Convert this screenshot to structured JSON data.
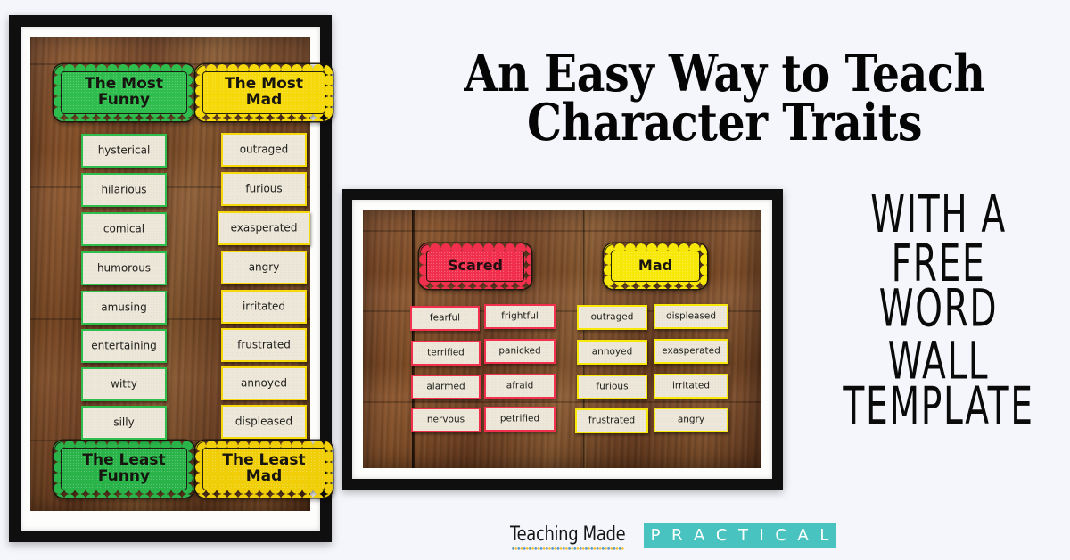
{
  "page": {
    "background_color": "#f5f6fc",
    "title_line1": "An Easy Way to Teach",
    "title_line2": "Character Traits",
    "subtext_lines": [
      "With a",
      "Free",
      "Word Wall",
      "Template"
    ]
  },
  "logo": {
    "brand_script": "Teaching Made",
    "brand_block": "P R A C T I C A L",
    "block_bg_color": "#49c3c0",
    "dot_colors": [
      "#e8443c",
      "#f0c030",
      "#4aa3d8",
      "#5cb85c",
      "#f0883c"
    ]
  },
  "photo_left": {
    "frame_color": "#100f0f",
    "mat_color": "#fdfdfb",
    "columns": [
      {
        "name": "funny",
        "accent_color": "#2fbd4e",
        "top_label": "The Most\nFunny",
        "top_label_line1": "The Most",
        "top_label_line2": "Funny",
        "bottom_label_line1": "The Least",
        "bottom_label_line2": "Funny",
        "words": [
          "hysterical",
          "hilarious",
          "comical",
          "humorous",
          "amusing",
          "entertaining",
          "witty",
          "silly"
        ]
      },
      {
        "name": "mad",
        "accent_color": "#f5d90a",
        "top_label_line1": "The Most",
        "top_label_line2": "Mad",
        "bottom_label_line1": "The Least",
        "bottom_label_line2": "Mad",
        "words": [
          "outraged",
          "furious",
          "exasperated",
          "angry",
          "irritated",
          "frustrated",
          "annoyed",
          "displeased"
        ]
      }
    ]
  },
  "photo_right": {
    "frame_color": "#100f0f",
    "mat_color": "#fdfdfb",
    "groups": [
      {
        "name": "scared",
        "header": "Scared",
        "accent_color": "#f0304c",
        "words": [
          "fearful",
          "frightful",
          "terrified",
          "panicked",
          "alarmed",
          "afraid",
          "nervous",
          "petrified"
        ]
      },
      {
        "name": "mad",
        "header": "Mad",
        "accent_color": "#f7e808",
        "words": [
          "outraged",
          "displeased",
          "annoyed",
          "exasperated",
          "furious",
          "irritated",
          "frustrated",
          "angry"
        ]
      }
    ]
  }
}
